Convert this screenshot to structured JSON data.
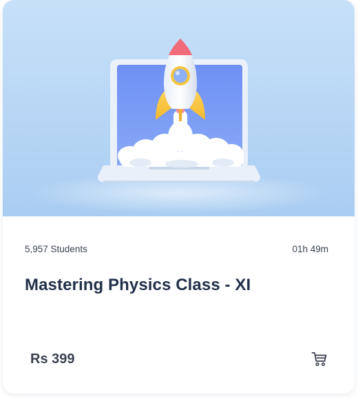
{
  "course": {
    "students": "5,957 Students",
    "duration": "01h 49m",
    "title": "Mastering Physics Class - XI",
    "price": "Rs 399"
  },
  "icons": {
    "cart": "cart-icon",
    "thumbnail": "rocket-launching-from-laptop"
  },
  "colors": {
    "title": "#23304a",
    "text": "#3a4250",
    "price": "#3b4150",
    "thumbnail_bg": "#b9d8f6",
    "laptop_screen": "#7a9cf5"
  }
}
